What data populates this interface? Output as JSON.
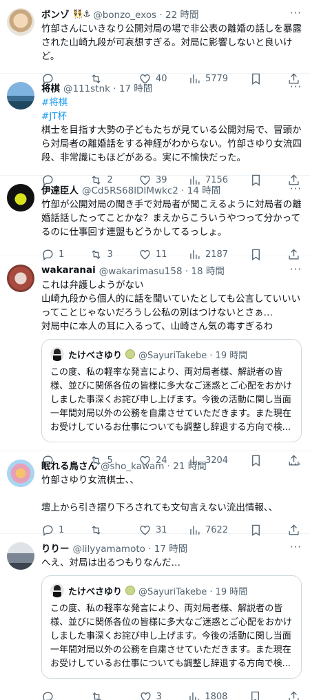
{
  "tweets": [
    {
      "name": "ボンゾ",
      "name_emoji": "👯⚓",
      "handle": "@bonzo_exos · 22 時間",
      "text": "竹部さんにいきなり公開対局の場で非公表の離婚の話しを暴露された山崎九段が可哀想すぎる。対局に影響しないと良いけど。",
      "reply": "",
      "retweet": "",
      "like": "40",
      "views": "5779"
    },
    {
      "name": "将棋",
      "handle": "@111stnk · 17 時間",
      "tags": [
        "#将棋",
        "#JT杯"
      ],
      "text": "棋士を目指す大勢の子どもたちが見ている公開対局で、冒頭から対局者の離婚話をする神経がわからない。竹部さゆり女流四段、非常識にもほどがある。実に不愉快だった。",
      "reply": "",
      "retweet": "2",
      "like": "39",
      "views": "7156"
    },
    {
      "name": "伊達臣人",
      "handle": "@Cd5RS68lDIMwkc2 · 14 時間",
      "text": "竹部が公開対局の聞き手で対局者が聞こえるように対局者の離婚話話したってことかな？まえからこういうやつって分かってるのに仕事回す連盟もどうかしてるっしょ。",
      "reply": "1",
      "retweet": "3",
      "like": "11",
      "views": "2187"
    },
    {
      "name": "wakaranai",
      "handle": "@wakarimasu158 · 18 時間",
      "text": "これは弁護しようがない\n山崎九段から個人的に話を聞いていたとしても公言していいいってことじゃないだろうし公私の別はつけないとさぁ…\n対局中に本人の耳に入るって、山崎さん気の毒すぎるわ",
      "quote": {
        "name": "たけべさゆり",
        "handle": "@SayuriTakebe · 19 時間",
        "text": "この度、私の軽率な発言により、両対局者様、解説者の皆様、並びに関係各位の皆様に多大なご迷惑とご心配をおかけしました事深くお詫び申し上げます。今後の活動に関し当面一年間対局以外の公務を自粛させていただきます。また現在お受けしているお仕事についても調整し辞退する方向で検..."
      },
      "reply": "",
      "retweet": "5",
      "like": "24",
      "views": "3204"
    },
    {
      "name": "眠れる鳥さん",
      "handle": "@sho_kawam · 21 時間",
      "text": "竹部さゆり女流棋士、、\n\n壇上から引き摺り下ろされても文句言えない流出情報、、",
      "reply": "1",
      "retweet": "",
      "like": "31",
      "views": "7622"
    },
    {
      "name": "りりー",
      "handle": "@lilyyamamoto · 17 時間",
      "text": "へえ、対局は出るつもりなんだ…",
      "quote": {
        "name": "たけべさゆり",
        "handle": "@SayuriTakebe · 19 時間",
        "text": "この度、私の軽率な発言により、両対局者様、解説者の皆様、並びに関係各位の皆様に多大なご迷惑とご心配をおかけしました事深くお詫び申し上げます。今後の活動に関し当面一年間対局以外の公務を自粛させていただきます。また現在お受けしているお仕事についても調整し辞退する方向で検..."
      },
      "reply": "",
      "retweet": "",
      "like": "3",
      "views": "1808"
    }
  ],
  "more_label": "···",
  "colors": {
    "accent": "#1d9bf0",
    "muted": "#536471",
    "border": "#eff3f4"
  }
}
